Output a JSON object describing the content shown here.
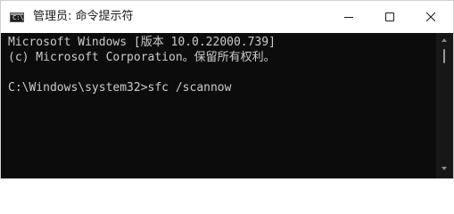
{
  "window": {
    "title": "管理员: 命令提示符",
    "icon_text": "C:\\",
    "icon_name": "console-icon"
  },
  "controls": {
    "minimize_icon": "minimize-icon",
    "maximize_icon": "maximize-icon",
    "close_icon": "close-icon"
  },
  "console": {
    "lines": [
      "Microsoft Windows [版本 10.0.22000.739]",
      "(c) Microsoft Corporation。保留所有权利。",
      "",
      "C:\\Windows\\system32>sfc /scannow"
    ]
  },
  "colors": {
    "console_bg": "#0c0c0c",
    "console_text": "#cccccc",
    "titlebar_bg": "#ffffff"
  }
}
